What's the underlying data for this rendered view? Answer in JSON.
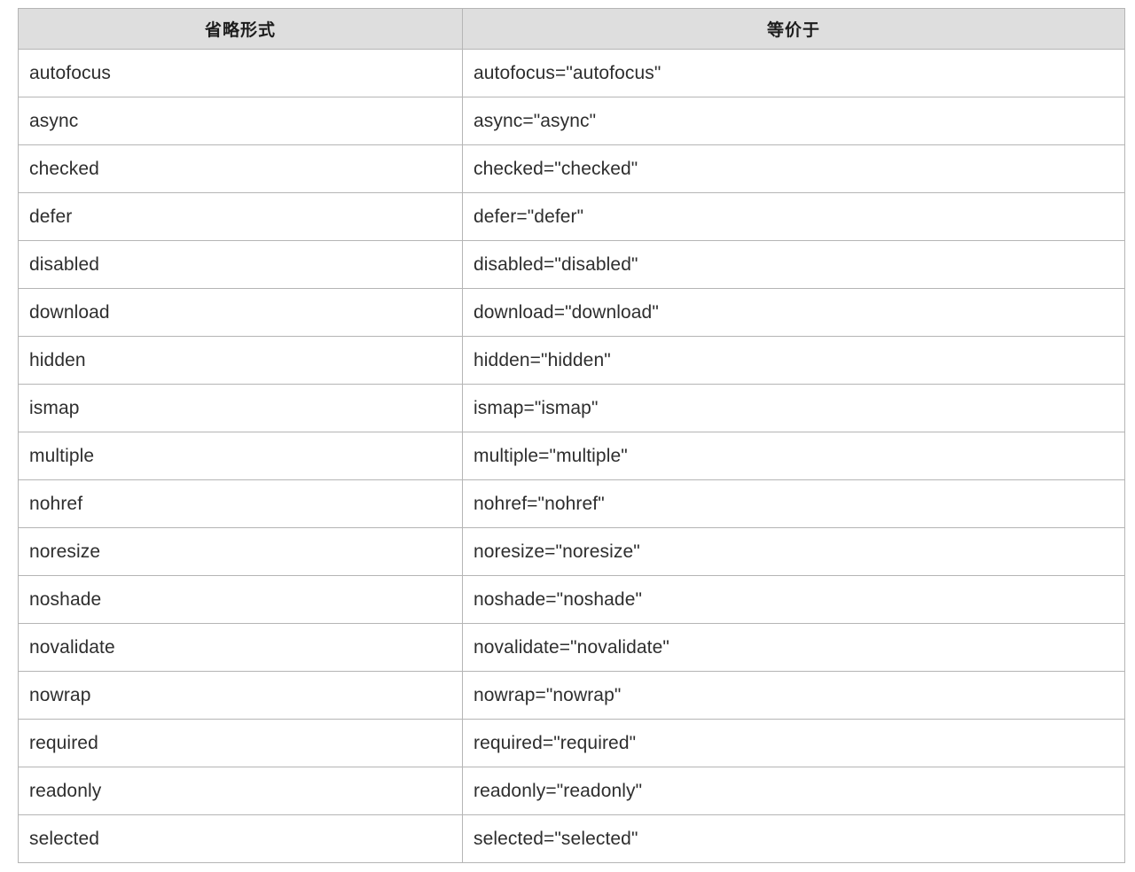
{
  "table": {
    "caption": "",
    "columns": [
      {
        "key": "short",
        "label": "省略形式"
      },
      {
        "key": "equivalent",
        "label": "等价于"
      }
    ],
    "rows": [
      {
        "short": "autofocus",
        "equivalent": "autofocus=\"autofocus\""
      },
      {
        "short": "async",
        "equivalent": "async=\"async\""
      },
      {
        "short": "checked",
        "equivalent": "checked=\"checked\""
      },
      {
        "short": "defer",
        "equivalent": "defer=\"defer\""
      },
      {
        "short": "disabled",
        "equivalent": "disabled=\"disabled\""
      },
      {
        "short": "download",
        "equivalent": "download=\"download\""
      },
      {
        "short": "hidden",
        "equivalent": "hidden=\"hidden\""
      },
      {
        "short": "ismap",
        "equivalent": "ismap=\"ismap\""
      },
      {
        "short": "multiple",
        "equivalent": "multiple=\"multiple\""
      },
      {
        "short": "nohref",
        "equivalent": "nohref=\"nohref\""
      },
      {
        "short": "noresize",
        "equivalent": "noresize=\"noresize\""
      },
      {
        "short": "noshade",
        "equivalent": "noshade=\"noshade\""
      },
      {
        "short": "novalidate",
        "equivalent": "novalidate=\"novalidate\""
      },
      {
        "short": "nowrap",
        "equivalent": "nowrap=\"nowrap\""
      },
      {
        "short": "required",
        "equivalent": "required=\"required\""
      },
      {
        "short": "readonly",
        "equivalent": "readonly=\"readonly\""
      },
      {
        "short": "selected",
        "equivalent": "selected=\"selected\""
      }
    ]
  },
  "colors": {
    "page_background": "#ffffff",
    "header_background": "#dedede",
    "border": "#b5b5b5",
    "text": "#2e2e2e",
    "header_text": "#1c1c1c"
  }
}
